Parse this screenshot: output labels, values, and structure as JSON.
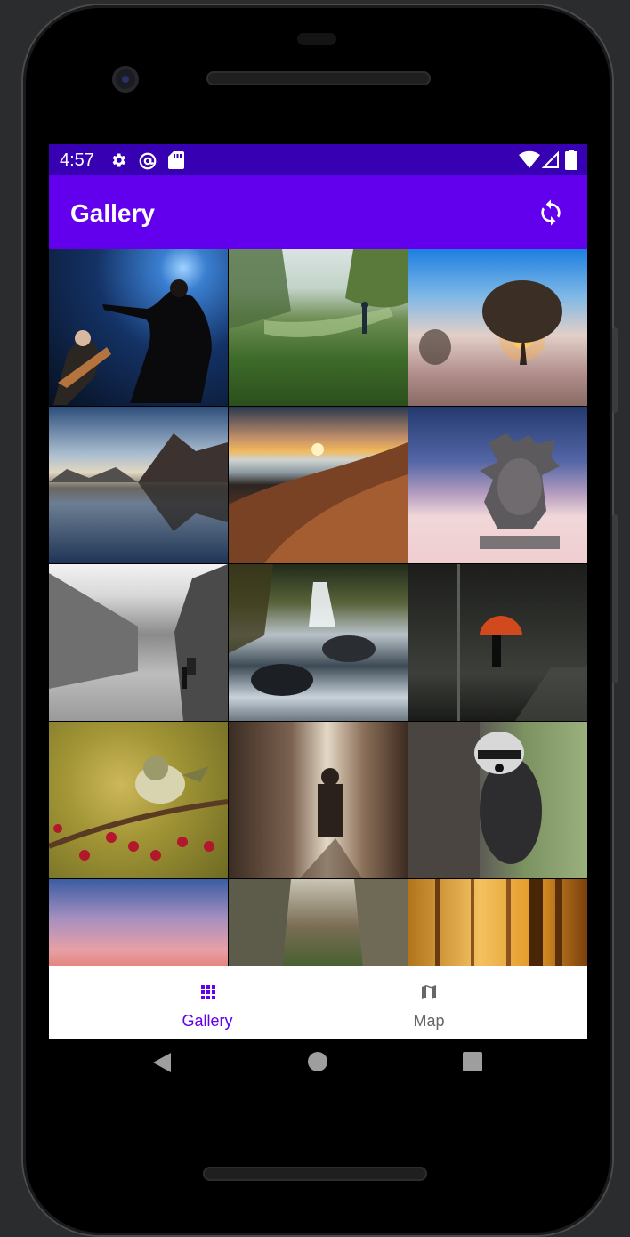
{
  "status_bar": {
    "time": "4:57",
    "left_icons": [
      "settings-icon",
      "at-sign-icon",
      "sd-card-icon"
    ],
    "right_icons": [
      "wifi-icon",
      "cell-signal-icon",
      "battery-icon"
    ]
  },
  "app_bar": {
    "title": "Gallery",
    "action_icon": "refresh-icon"
  },
  "gallery": {
    "photos": [
      "concert-performers",
      "grassy-path-walker",
      "misty-tree-sunrise",
      "mountain-lake-reflection",
      "sunset-over-hills",
      "desert-sculpture-head",
      "black-white-street",
      "forest-waterfall",
      "red-umbrella-figure",
      "bird-on-berry-branch",
      "man-in-alley",
      "raccoon-on-tree",
      "pink-sunset-clouds",
      "rocky-canyon",
      "golden-forest-light"
    ]
  },
  "bottom_nav": {
    "items": [
      {
        "label": "Gallery",
        "icon": "grid-icon",
        "selected": true
      },
      {
        "label": "Map",
        "icon": "map-icon",
        "selected": false
      }
    ]
  },
  "system_nav": {
    "buttons": [
      "back-button",
      "home-button",
      "recents-button"
    ]
  },
  "colors": {
    "primary": "#6200ee",
    "primary_dark": "#3700b3",
    "selected_nav": "#6200ee",
    "unselected_nav": "#666666"
  }
}
